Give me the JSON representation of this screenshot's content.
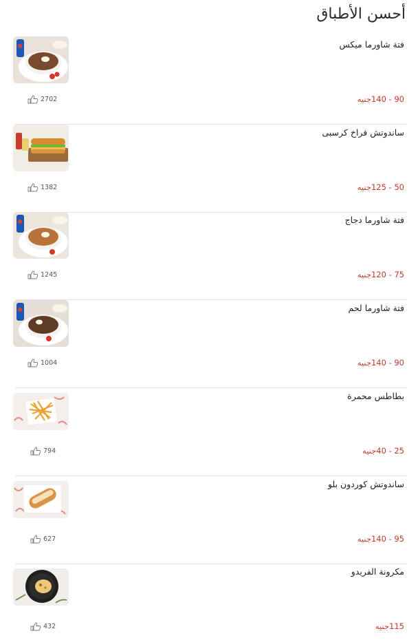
{
  "page": {
    "title": "أحسن الأطباق"
  },
  "dishes": [
    {
      "name": "فتة شاورما ميكس",
      "price": "90 - 140جنيه",
      "likes": "2702",
      "image": "shawarma-fatteh-mix-photo"
    },
    {
      "name": "ساندوتش فراخ كرسبى",
      "price": "50 - 125جنيه",
      "likes": "1382",
      "image": "crispy-chicken-sandwich-photo"
    },
    {
      "name": "فتة شاورما دجاج",
      "price": "75 - 120جنيه",
      "likes": "1245",
      "image": "chicken-shawarma-fatteh-photo"
    },
    {
      "name": "فتة شاورما لحم",
      "price": "90 - 140جنيه",
      "likes": "1004",
      "image": "meat-shawarma-fatteh-photo"
    },
    {
      "name": "بطاطس محمرة",
      "price": "25 - 40جنيه",
      "likes": "794",
      "image": "french-fries-photo"
    },
    {
      "name": "ساندوتش كوردون بلو",
      "price": "95 - 140جنيه",
      "likes": "627",
      "image": "cordon-bleu-sandwich-photo"
    },
    {
      "name": "مكرونة الفريدو",
      "price": "115جنيه",
      "likes": "432",
      "image": "fettuccine-alfredo-photo"
    }
  ],
  "colors": {
    "price": "#c0392b",
    "divider": "#e3e3e3"
  },
  "icons": {
    "like": "thumbs-up-icon"
  }
}
